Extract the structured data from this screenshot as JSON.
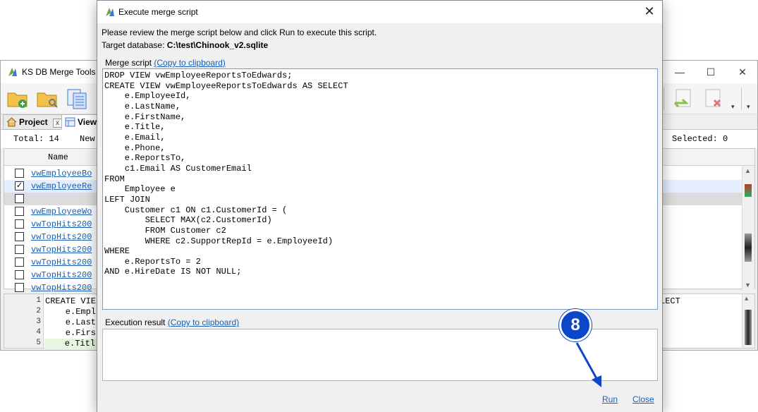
{
  "background_window": {
    "title": "KS DB Merge Tools fo",
    "controls": {
      "minimize": "—",
      "maximize": "☐",
      "close": "✕"
    },
    "tabs": [
      {
        "label": "Project",
        "close": "x"
      },
      {
        "label": "View"
      }
    ],
    "status": {
      "total": "Total: 14",
      "new": "New",
      "selected": "Selected: 0"
    },
    "grid_header": {
      "name": "Name"
    },
    "rows": [
      {
        "name": "vwEmployeeBo",
        "checked": false
      },
      {
        "name": "vwEmployeeRe",
        "checked": true
      },
      {
        "name": "",
        "checked": false
      },
      {
        "name": "vwEmployeeWo",
        "checked": false
      },
      {
        "name": "vwTopHits200",
        "checked": false
      },
      {
        "name": "vwTopHits200",
        "checked": false
      },
      {
        "name": "vwTopHits200",
        "checked": false
      },
      {
        "name": "vwTopHits200",
        "checked": false
      },
      {
        "name": "vwTopHits200",
        "checked": false
      },
      {
        "name": "vwTopHits200",
        "checked": false
      }
    ],
    "code_lines": [
      {
        "num": "1",
        "text": "CREATE VIE"
      },
      {
        "num": "2",
        "text": "    e.Empl"
      },
      {
        "num": "3",
        "text": "    e.Last"
      },
      {
        "num": "4",
        "text": "    e.Firs"
      },
      {
        "num": "5",
        "text": "    e.Titl"
      }
    ],
    "code_right": "LECT"
  },
  "dialog": {
    "title": "Execute merge script",
    "close": "✕",
    "instruction": "Please review the merge script below and click Run to execute this script.",
    "target_label": "Target database:",
    "target_value": "C:\\test\\Chinook_v2.sqlite",
    "merge_script_label": "Merge script",
    "copy_link": "(Copy to clipboard)",
    "script_lines": [
      "DROP VIEW vwEmployeeReportsToEdwards;",
      "CREATE VIEW vwEmployeeReportsToEdwards AS SELECT",
      "    e.EmployeeId,",
      "    e.LastName,",
      "    e.FirstName,",
      "    e.Title,",
      "    e.Email,",
      "    e.Phone,",
      "    e.ReportsTo,",
      "    c1.Email AS CustomerEmail",
      "FROM",
      "    Employee e",
      "LEFT JOIN",
      "    Customer c1 ON c1.CustomerId = (",
      "        SELECT MAX(c2.CustomerId)",
      "        FROM Customer c2",
      "        WHERE c2.SupportRepId = e.EmployeeId)",
      "WHERE",
      "    e.ReportsTo = 2",
      "AND e.HireDate IS NOT NULL;"
    ],
    "execution_label": "Execution result",
    "execution_copy_link": "(Copy to clipboard)",
    "run_label": "Run",
    "close_label": "Close"
  },
  "annotation": {
    "step": "8",
    "color": "#0d47c9"
  }
}
